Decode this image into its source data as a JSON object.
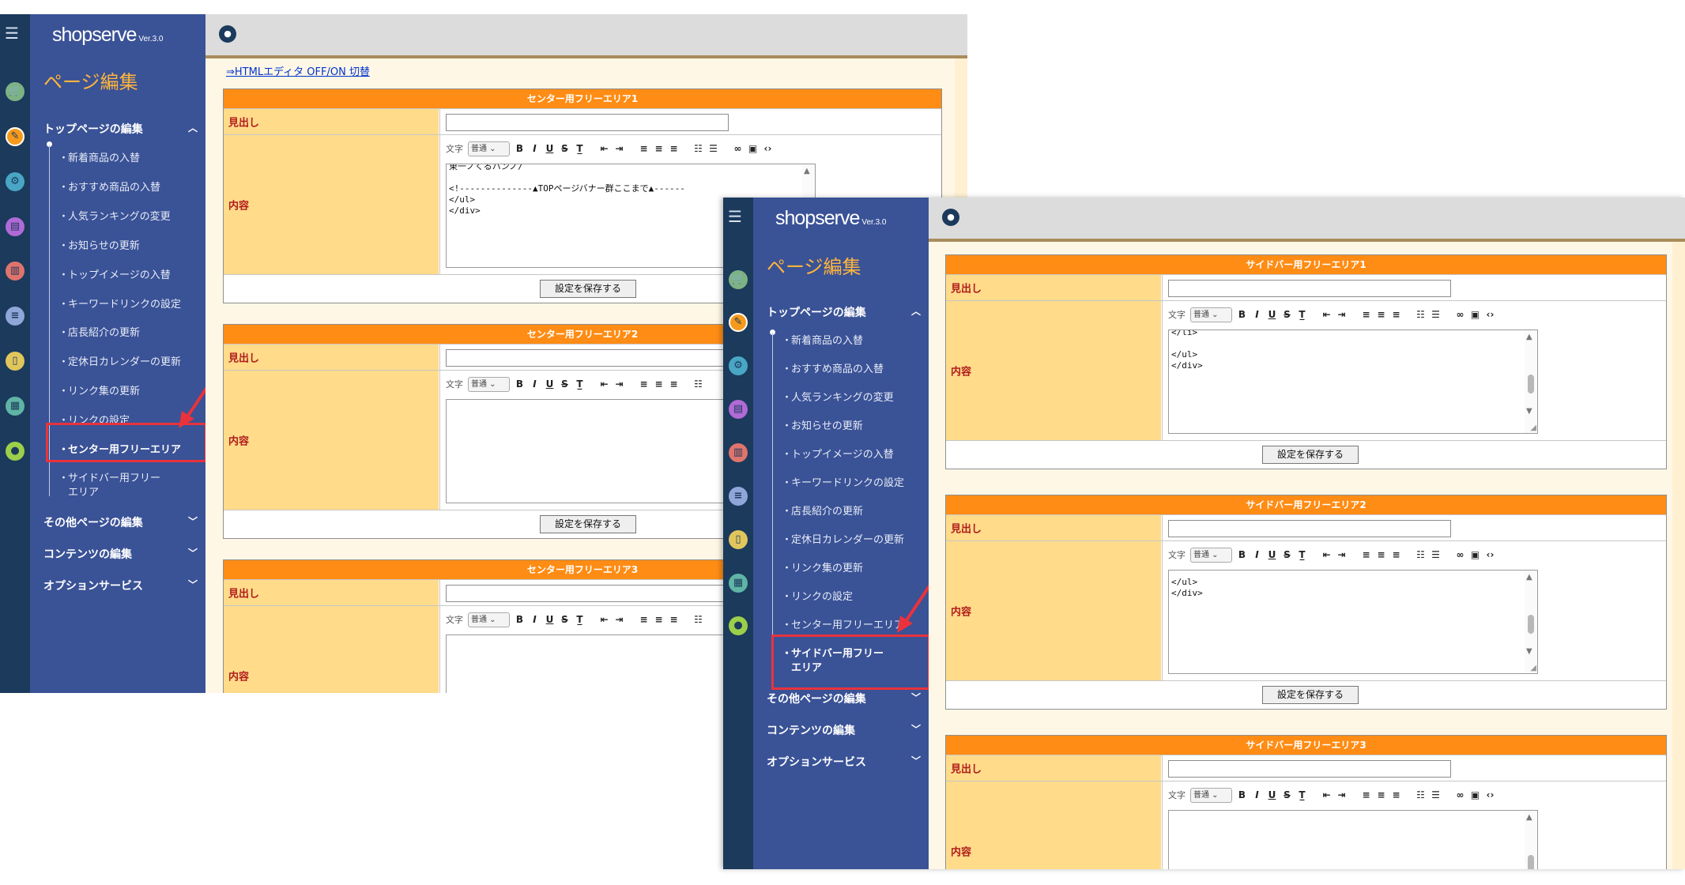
{
  "brand": {
    "logo_text": "shopserve",
    "version": "Ver.3.0"
  },
  "menu_icon": "☰",
  "icons": [
    "cart-icon",
    "edit-icon",
    "gear-icon",
    "layout-icon",
    "chart-icon",
    "database-icon",
    "mobile-icon",
    "clipboard-icon",
    "users-icon"
  ],
  "sidebar": {
    "section_title": "ページ編集",
    "groups": {
      "top": "トップページの編集",
      "other": "その他ページの編集",
      "content": "コンテンツの編集",
      "option": "オプションサービス"
    },
    "items": [
      "新着商品の入替",
      "おすすめ商品の入替",
      "人気ランキングの変更",
      "お知らせの更新",
      "トップイメージの入替",
      "キーワードリンクの設定",
      "店長紹介の更新",
      "定休日カレンダーの更新",
      "リンク集の更新",
      "リンクの設定",
      "センター用フリーエリア",
      "サイドバー用フリーエリア"
    ],
    "side_item_wrap": [
      "サイドバー用フリー",
      "エリア"
    ]
  },
  "html_toggle": "⇒HTMLエディタ OFF/ON 切替",
  "labels": {
    "heading": "見出し",
    "content": "内容",
    "save": "設定を保存する"
  },
  "toolbar": {
    "text_label": "文字",
    "font_select": "普通"
  },
  "center_panels": [
    "センター用フリーエリア1",
    "センター用フリーエリア2",
    "センター用フリーエリア3"
  ],
  "side_panels": [
    "サイドバー用フリーエリア1",
    "サイドバー用フリーエリア2",
    "サイドバー用フリーエリア3"
  ],
  "editor_text": {
    "center1": [
      "東一ノくるハンノ/",
      "",
      "<!--------------▲TOPページバナー群ここまで▲------",
      "</ul>",
      "</div>"
    ],
    "side1": [
      "</li>",
      "",
      "</ul>",
      "</div>"
    ],
    "side2": [
      "</ul>",
      "</div>"
    ]
  }
}
